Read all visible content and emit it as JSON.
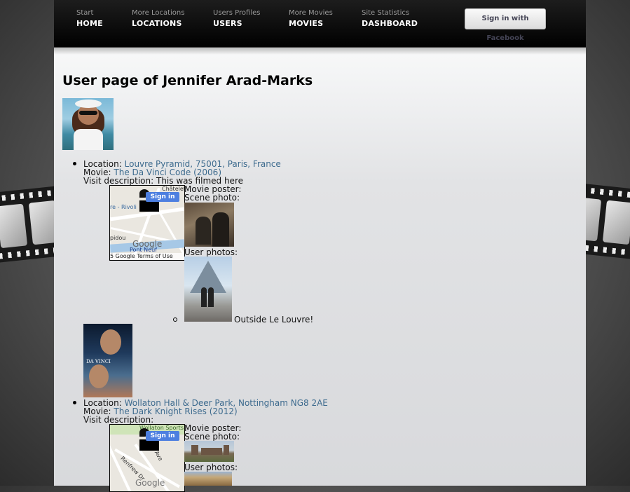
{
  "nav": {
    "items": [
      {
        "sub": "Start",
        "main": "HOME"
      },
      {
        "sub": "More Locations",
        "main": "LOCATIONS"
      },
      {
        "sub": "Users Profiles",
        "main": "USERS"
      },
      {
        "sub": "More Movies",
        "main": "MOVIES"
      },
      {
        "sub": "Site Statistics",
        "main": "DASHBOARD"
      }
    ],
    "fb_button": "Sign in with Facebook"
  },
  "page_title": "User page of Jennifer Arad-Marks",
  "labels": {
    "location": "Location:",
    "movie": "Movie:",
    "visit_description": "Visit description:",
    "movie_poster": "Movie poster:",
    "scene_photo": "Scene photo:",
    "user_photos": "User photos:"
  },
  "map": {
    "sign_in": "Sign in",
    "terms": "5 Google   Terms of Use"
  },
  "visits": [
    {
      "location": "Louvre Pyramid, 75001, Paris, France",
      "movie": "The Da Vinci Code (2006)",
      "description": "This was filmed here",
      "user_photo_caption": "Outside Le Louvre!",
      "map_labels": [
        "Châtelet",
        "re - Rivoli",
        "Pont Neuf",
        "Google",
        "pidou"
      ]
    },
    {
      "location": "Wollaton Hall & Deer Park, Nottingham NG8 2AE",
      "movie": "The Dark Knight Rises (2012)",
      "description": "",
      "map_labels": [
        "Wollaton Sports",
        "Renfrew Dr",
        "Ave",
        "Google"
      ]
    }
  ]
}
